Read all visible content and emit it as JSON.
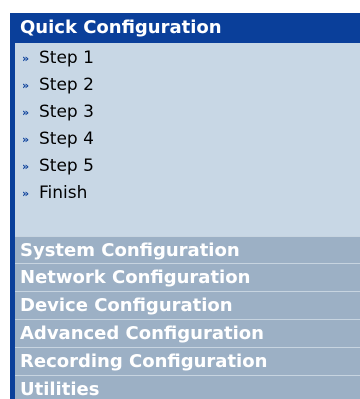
{
  "quick_config": {
    "title": "Quick Configuration",
    "steps": [
      {
        "label": "Step 1",
        "icon": "double-arrow-icon"
      },
      {
        "label": "Step 2",
        "icon": "double-arrow-icon"
      },
      {
        "label": "Step 3",
        "icon": "double-arrow-icon"
      },
      {
        "label": "Step 4",
        "icon": "double-arrow-icon"
      },
      {
        "label": "Step 5",
        "icon": "double-arrow-icon"
      },
      {
        "label": "Finish",
        "icon": "double-arrow-icon"
      }
    ]
  },
  "sections": [
    {
      "label": "System Configuration"
    },
    {
      "label": "Network Configuration"
    },
    {
      "label": "Device Configuration"
    },
    {
      "label": "Advanced Configuration"
    },
    {
      "label": "Recording Configuration"
    },
    {
      "label": "Utilities"
    }
  ],
  "colors": {
    "header_bg": "#0a3f9a",
    "panel_bg": "#c8d7e5",
    "section_bg": "#9cb0c5",
    "text_white": "#ffffff"
  }
}
